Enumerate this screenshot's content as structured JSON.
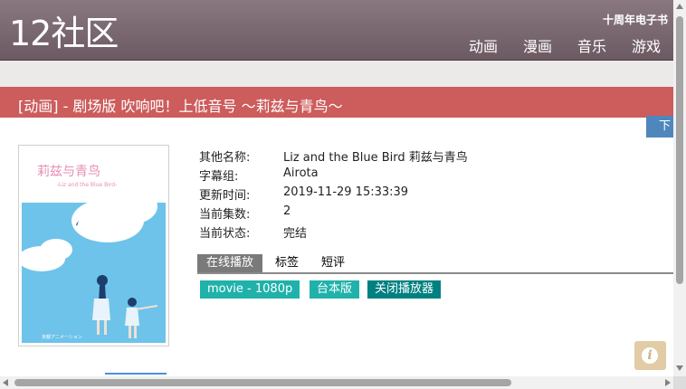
{
  "header": {
    "logo": "12社区",
    "top_link": "十周年电子书",
    "nav": [
      "动画",
      "漫画",
      "音乐",
      "游戏"
    ]
  },
  "title_bar": "[动画] - 剧场版 吹响吧！上低音号 ～莉兹与青鸟～",
  "download_tab": "下",
  "poster": {
    "title_cn": "莉兹与青鸟",
    "title_en": "-Liz and the Blue Bird-",
    "studio": "京都アニメーション"
  },
  "info": {
    "rows": [
      {
        "key": "其他名称:",
        "value": "Liz and the Blue Bird 莉兹与青鸟"
      },
      {
        "key": "字幕组:",
        "value": "Airota"
      },
      {
        "key": "更新时间:",
        "value": "2019-11-29 15:33:39"
      },
      {
        "key": "当前集数:",
        "value": "2"
      },
      {
        "key": "当前状态:",
        "value": "完结"
      }
    ]
  },
  "tabs": [
    "在线播放",
    "标签",
    "短评"
  ],
  "player_buttons": [
    {
      "label": "movie - 1080p",
      "color": "#20b2aa"
    },
    {
      "label": "台本版",
      "color": "#20b2aa"
    },
    {
      "label": "关闭播放器",
      "color": "#008080"
    }
  ],
  "info_icon": "i",
  "colors": {
    "header": "#6c5a62",
    "title_bar": "#cd5c5c",
    "download_tab": "#4f87bd",
    "info_button": "#e2cca5"
  }
}
